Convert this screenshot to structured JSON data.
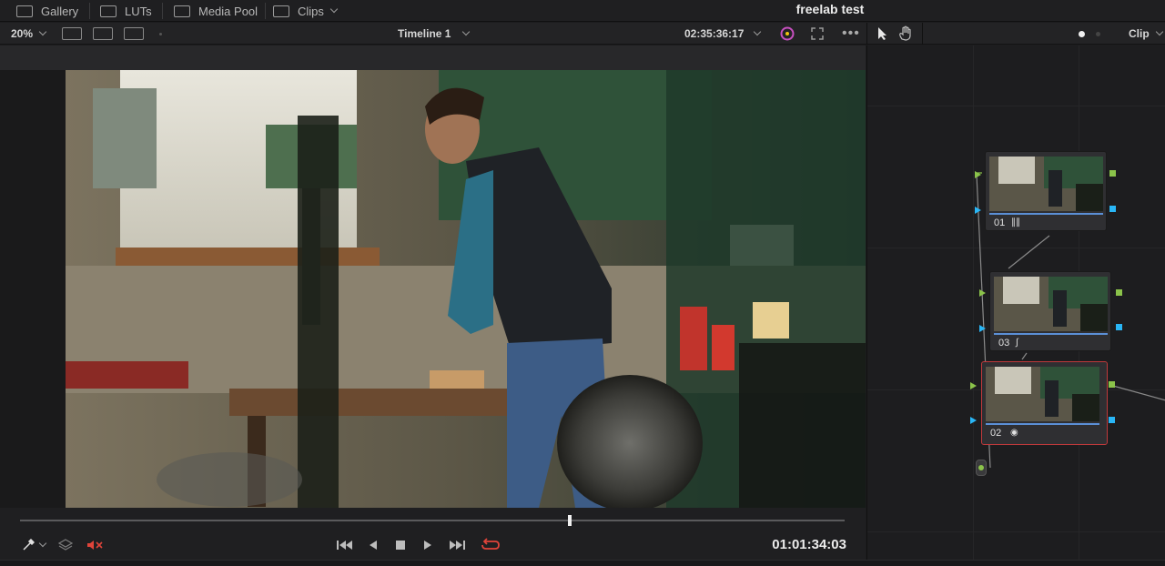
{
  "topbar": {
    "tabs": [
      {
        "label": "Gallery",
        "icon": "gallery-icon"
      },
      {
        "label": "LUTs",
        "icon": "luts-icon"
      },
      {
        "label": "Media Pool",
        "icon": "media-pool-icon"
      },
      {
        "label": "Clips",
        "icon": "clips-icon"
      }
    ],
    "project_title": "freelab test"
  },
  "viewer_toolbar": {
    "zoom": "20%",
    "timeline_name": "Timeline 1",
    "timecode": "02:35:36:17"
  },
  "node_toolbar": {
    "mode": "Clip"
  },
  "nodes": [
    {
      "number": "01",
      "icon": "bars-icon",
      "selected": false
    },
    {
      "number": "03",
      "icon": "curve-icon",
      "selected": false
    },
    {
      "number": "02",
      "icon": "fx-icon",
      "selected": true
    }
  ],
  "transport": {
    "timecode": "01:01:34:03",
    "playhead_fraction": 0.667
  },
  "colors": {
    "accent_red": "#e0443a",
    "node_selected": "#c0393b",
    "input_green": "#8bc34a",
    "port_blue": "#29b6f6",
    "node_bar_blue": "#5b8fd6"
  }
}
